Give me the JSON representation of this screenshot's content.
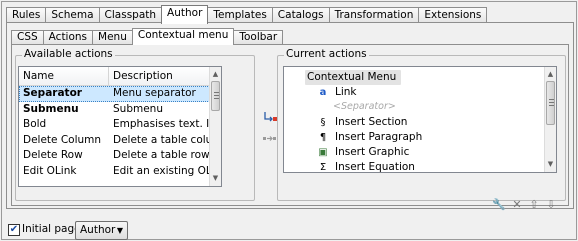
{
  "main_tabs": [
    "Rules",
    "Schema",
    "Classpath",
    "Author",
    "Templates",
    "Catalogs",
    "Transformation",
    "Extensions"
  ],
  "main_tabs_active": "Author",
  "sub_tabs": [
    "CSS",
    "Actions",
    "Menu",
    "Contextual menu",
    "Toolbar"
  ],
  "sub_tabs_active": "Contextual menu",
  "available": {
    "title": "Available actions",
    "columns": [
      "Name",
      "Description"
    ],
    "rows": [
      {
        "name": "Separator",
        "desc": "Menu separator",
        "bold": true,
        "selected": true
      },
      {
        "name": "Submenu",
        "desc": "Submenu",
        "bold": true,
        "selected": false
      },
      {
        "name": "Bold",
        "desc": "Emphasises text. Inserts",
        "bold": false,
        "selected": false
      },
      {
        "name": "Delete Column",
        "desc": "Delete a table column",
        "bold": false,
        "selected": false
      },
      {
        "name": "Delete Row",
        "desc": "Delete a table row",
        "bold": false,
        "selected": false
      },
      {
        "name": "Edit OLink",
        "desc": "Edit an existing OLink",
        "bold": false,
        "selected": false
      }
    ]
  },
  "current": {
    "title": "Current actions",
    "root": "Contextual Menu",
    "items": [
      {
        "label": "Link",
        "icon": "a",
        "icon_name": "link-icon"
      },
      {
        "label": "<Separator>",
        "icon": "",
        "icon_name": "",
        "separator": true
      },
      {
        "label": "Insert Section",
        "icon": "§",
        "icon_name": "section-icon"
      },
      {
        "label": "Insert Paragraph",
        "icon": "¶",
        "icon_name": "paragraph-icon"
      },
      {
        "label": "Insert Graphic",
        "icon": "▣",
        "icon_name": "graphic-icon"
      },
      {
        "label": "Insert Equation",
        "icon": "Σ",
        "icon_name": "equation-icon"
      }
    ]
  },
  "footer": {
    "initial_page_label": "Initial page",
    "initial_page_checked": true,
    "initial_page_value": "Author"
  }
}
